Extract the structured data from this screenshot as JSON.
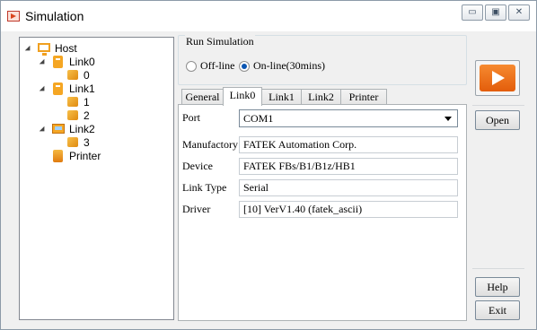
{
  "window": {
    "title": "Simulation"
  },
  "caption_buttons": {
    "minimize": "▭",
    "maximize": "▣",
    "close": "✕"
  },
  "tree": {
    "items": [
      {
        "label": "Host",
        "icon": "host-icon"
      },
      {
        "label": "Link0",
        "icon": "link-icon"
      },
      {
        "label": "0",
        "icon": "device-cube-icon"
      },
      {
        "label": "Link1",
        "icon": "link-icon"
      },
      {
        "label": "1",
        "icon": "device-cube-icon"
      },
      {
        "label": "2",
        "icon": "device-cube-icon"
      },
      {
        "label": "Link2",
        "icon": "network-link-icon"
      },
      {
        "label": "3",
        "icon": "device-cube-icon"
      },
      {
        "label": "Printer",
        "icon": "printer-icon"
      }
    ]
  },
  "run_simulation": {
    "title": "Run Simulation",
    "options": [
      {
        "label": "Off-line",
        "checked": false
      },
      {
        "label": "On-line(30mins)",
        "checked": true
      }
    ]
  },
  "tabs": [
    {
      "label": "General",
      "active": false
    },
    {
      "label": "Link0",
      "active": true
    },
    {
      "label": "Link1",
      "active": false
    },
    {
      "label": "Link2",
      "active": false
    },
    {
      "label": "Printer",
      "active": false
    }
  ],
  "form": {
    "port": {
      "label": "Port",
      "value": "COM1"
    },
    "manufactory": {
      "label": "Manufactory",
      "value": "FATEK Automation Corp."
    },
    "device": {
      "label": "Device",
      "value": "FATEK FBs/B1/B1z/HB1"
    },
    "link_type": {
      "label": "Link Type",
      "value": "Serial"
    },
    "driver": {
      "label": "Driver",
      "value": "[10] VerV1.40 (fatek_ascii)"
    }
  },
  "buttons": {
    "run": "play-icon",
    "open": "Open",
    "help": "Help",
    "exit": "Exit"
  },
  "colors": {
    "run_button": "#ec6a13",
    "selected_radio": "#0a55b2"
  }
}
